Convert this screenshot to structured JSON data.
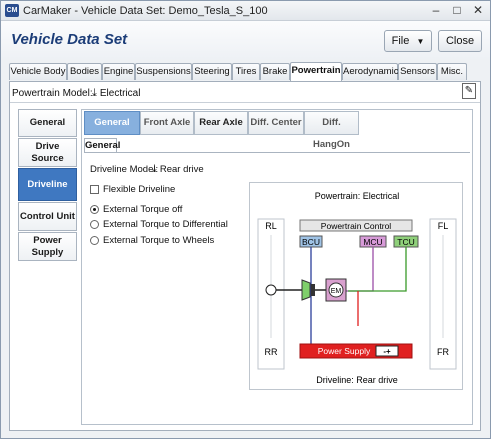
{
  "window": {
    "app_icon": "CM",
    "title": "CarMaker - Vehicle Data Set: Demo_Tesla_S_100"
  },
  "header": {
    "title": "Vehicle Data Set",
    "file_label": "File",
    "close_label": "Close"
  },
  "tabs": [
    {
      "label": "Vehicle Body"
    },
    {
      "label": "Bodies"
    },
    {
      "label": "Engine"
    },
    {
      "label": "Suspensions"
    },
    {
      "label": "Steering"
    },
    {
      "label": "Tires"
    },
    {
      "label": "Brake"
    },
    {
      "label": "Powertrain",
      "active": true
    },
    {
      "label": "Aerodynamics"
    },
    {
      "label": "Sensors"
    },
    {
      "label": "Misc."
    }
  ],
  "powertrain": {
    "model_label": "Powertrain Model:",
    "model_value": "Electrical"
  },
  "sidetabs": [
    {
      "label": "General"
    },
    {
      "label": "Drive Source"
    },
    {
      "label": "Driveline",
      "active": true
    },
    {
      "label": "Control Unit"
    },
    {
      "label": "Power Supply"
    }
  ],
  "subtabs": [
    {
      "label": "General",
      "active": true
    },
    {
      "label": "Front Axle"
    },
    {
      "label": "Rear Axle"
    },
    {
      "label": "Diff. Center"
    },
    {
      "label": "Diff. HangOn"
    }
  ],
  "general_tab": "General",
  "driveline": {
    "model_label": "Driveline Model:",
    "model_value": "Rear drive",
    "flexible_label": "Flexible Driveline",
    "flexible_checked": false,
    "torque_options": [
      {
        "label": "External Torque off",
        "selected": true
      },
      {
        "label": "External Torque to Differential",
        "selected": false
      },
      {
        "label": "External Torque to Wheels",
        "selected": false
      }
    ]
  },
  "diagram": {
    "title": "Powertrain: Electrical",
    "caption": "Driveline: Rear drive",
    "wheels": {
      "rl": "RL",
      "fl": "FL",
      "rr": "RR",
      "fr": "FR"
    },
    "control": "Powertrain Control",
    "bcu": "BCU",
    "mcu": "MCU",
    "tcu": "TCU",
    "em": "EM",
    "power_supply": "Power Supply",
    "battery_sign": "-+",
    "colors": {
      "bcu": "#9fc3e6",
      "mcu": "#d79ad8",
      "tcu": "#8fd07a",
      "power": "#e02020",
      "motor": "#d9a0cf",
      "gear": "#7fcf6b"
    }
  }
}
